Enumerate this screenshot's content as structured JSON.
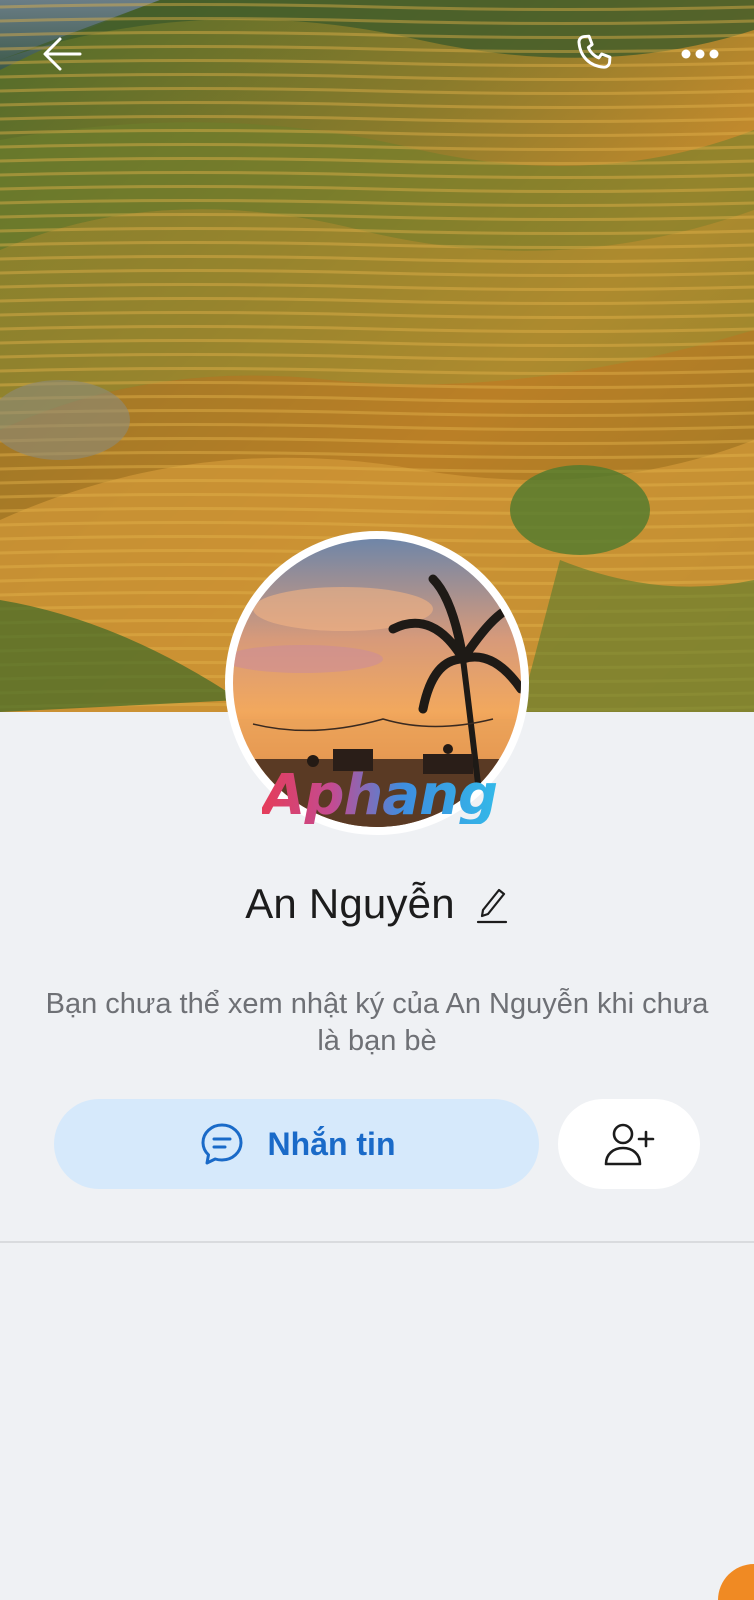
{
  "header": {
    "back_icon": "arrow-left-icon",
    "call_icon": "phone-icon",
    "more_icon": "more-horizontal-icon"
  },
  "profile": {
    "name": "An Nguyễn",
    "edit_icon": "pencil-icon",
    "watermark": "Aphang",
    "notice": "Bạn chưa thể xem nhật ký của An Nguyễn khi chưa là bạn bè"
  },
  "actions": {
    "message_label": "Nhắn tin",
    "message_icon": "chat-bubble-icon",
    "add_friend_icon": "add-user-icon"
  },
  "colors": {
    "accent": "#1a6ac8",
    "message_button_bg": "#d6e9fb",
    "background": "#eff1f4"
  }
}
